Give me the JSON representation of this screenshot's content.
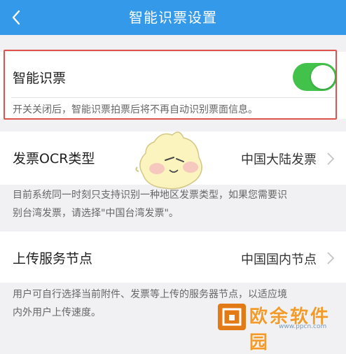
{
  "header": {
    "title": "智能识票设置",
    "back_icon": "chevron-left-icon",
    "color": "#3399e8"
  },
  "smart_ticket": {
    "label": "智能识票",
    "enabled": true,
    "toggle_color": "#42c24a",
    "description": "开关关闭后，智能识票拍票后将不再自动识别票面信息。"
  },
  "invoice_ocr": {
    "label": "发票OCR类型",
    "value": "中国大陆发票",
    "description_line1": "目前系统同一时刻只支持识别一种地区发票类型，如果您需要识",
    "description_line2": "别台湾发票，请选择\"中国台湾发票\"。"
  },
  "upload_node": {
    "label": "上传服务节点",
    "value": "中国国内节点",
    "description_line1": "用户可自行选择当前附件、发票等上传的服务器节点，以适应境",
    "description_line2": "内外用户上传速度。"
  },
  "overlay": {
    "highlight_color": "#e0534d",
    "mascot_icon": "mascot-icon",
    "watermark_text": "欧余软件园",
    "watermark_url": "www.ppcn.com"
  }
}
